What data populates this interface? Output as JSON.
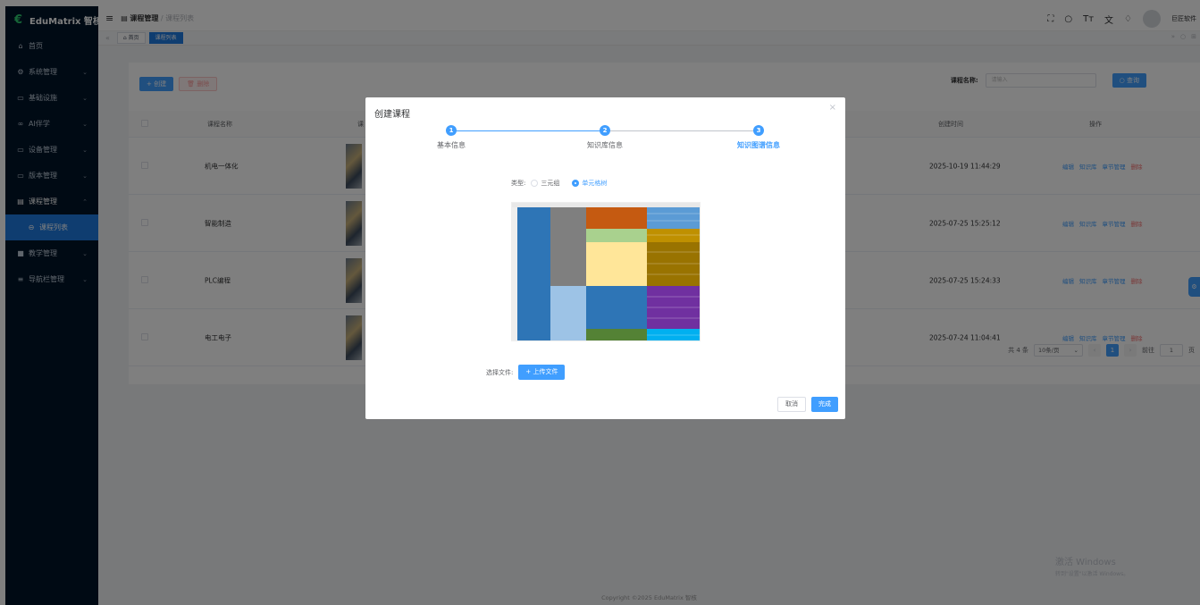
{
  "app": {
    "logo_text": "EduMatrix 智核"
  },
  "sidebar": {
    "items": [
      {
        "icon": "home-icon",
        "glyph": "⌂",
        "label": "首页"
      },
      {
        "icon": "gear-icon",
        "glyph": "⚙",
        "label": "系统管理"
      },
      {
        "icon": "monitor-icon",
        "glyph": "▭",
        "label": "基础设施"
      },
      {
        "icon": "ai-icon",
        "glyph": "∞",
        "label": "AI伴学"
      },
      {
        "icon": "device-icon",
        "glyph": "▭",
        "label": "设备管理"
      },
      {
        "icon": "folder-icon",
        "glyph": "▭",
        "label": "版本管理"
      },
      {
        "icon": "course-icon",
        "glyph": "▤",
        "label": "课程管理"
      },
      {
        "icon": "list-icon",
        "glyph": "⊖",
        "label": "课程列表"
      },
      {
        "icon": "teach-icon",
        "glyph": "■",
        "label": "教学管理"
      },
      {
        "icon": "nav-icon",
        "glyph": "≡",
        "label": "导航栏管理"
      }
    ]
  },
  "topbar": {
    "menu_glyph": "≡",
    "crumb_parent": "课程管理",
    "crumb_sep": "/",
    "crumb_current": "课程列表",
    "user": "巨匠软件"
  },
  "tags": {
    "home": "首页",
    "current": "课程列表"
  },
  "toolbar": {
    "create": "+ 创建",
    "delete": "删除"
  },
  "search": {
    "label": "课程名称:",
    "placeholder": "请输入",
    "button": "查询"
  },
  "table": {
    "headers": {
      "name": "课程名称",
      "cover": "课",
      "created": "创建时间",
      "ops": "操作"
    },
    "rows": [
      {
        "name": "机电一体化",
        "created": "2025-10-19 11:44:29"
      },
      {
        "name": "智能制造",
        "created": "2025-07-25 15:25:12"
      },
      {
        "name": "PLC编程",
        "created": "2025-07-25 15:24:33"
      },
      {
        "name": "电工电子",
        "created": "2025-07-24 11:04:41"
      }
    ],
    "ops": {
      "edit": "编辑",
      "kb": "知识库",
      "chapter": "章节管理",
      "del": "删除"
    }
  },
  "pagination": {
    "total": "共 4 条",
    "size": "10条/页",
    "page": "1",
    "goto": "前往",
    "goto_value": "1",
    "unit": "页"
  },
  "footer": {
    "copyright": "Copyright ©2025 EduMatrix 智核"
  },
  "watermark": {
    "line1": "激活 Windows",
    "line2": "转到\"设置\"以激活 Windows。"
  },
  "dialog": {
    "title": "创建课程",
    "close": "×",
    "steps": [
      {
        "num": "1",
        "label": "基本信息"
      },
      {
        "num": "2",
        "label": "知识库信息"
      },
      {
        "num": "3",
        "label": "知识图谱信息"
      }
    ],
    "current_step": 3,
    "type_label": "类型:",
    "type_options": [
      "三元组",
      "单元格树"
    ],
    "type_selected": "单元格树",
    "file_label": "选择文件:",
    "upload_button": "+ 上传文件",
    "cancel": "取消",
    "done": "完成"
  },
  "colors": {
    "sidebar": "#001529",
    "primary": "#409eff",
    "danger": "#f56c6c"
  }
}
